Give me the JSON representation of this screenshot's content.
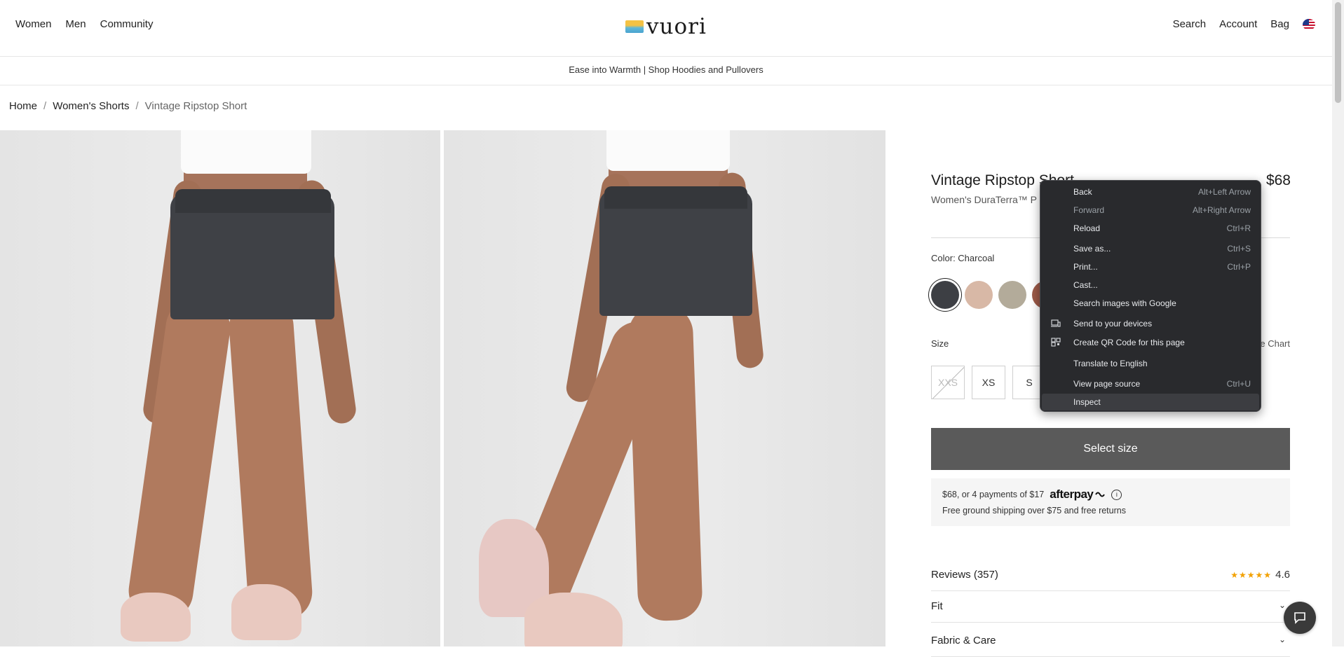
{
  "header": {
    "nav_left": [
      "Women",
      "Men",
      "Community"
    ],
    "logo_text": "vuori",
    "nav_right": [
      "Search",
      "Account",
      "Bag"
    ],
    "flag_icon": "us-flag-icon"
  },
  "banner": {
    "text": "Ease into Warmth | Shop Hoodies and Pullovers"
  },
  "breadcrumb": {
    "items": [
      "Home",
      "Women's Shorts",
      "Vintage Ripstop Short"
    ],
    "separator": "/"
  },
  "product": {
    "title": "Vintage Ripstop Short",
    "price": "$68",
    "subtitle": "Women's DuraTerra™ P",
    "color_label": "Color: Charcoal",
    "swatches": [
      "#3d3f44",
      "#d8b8a6",
      "#b3ab9a",
      "#9c5a48"
    ],
    "size_label": "Size",
    "size_chart_label": "e Chart",
    "sizes": [
      "XXS",
      "XS",
      "S"
    ],
    "select_button": "Select size",
    "afterpay_text": "$68, or 4 payments of $17",
    "afterpay_logo": "afterpay",
    "afterpay_info": "i",
    "shipping_text": "Free ground shipping over $75 and free returns",
    "reviews_label": "Reviews (357)",
    "stars": "★★★★★",
    "rating": "4.6",
    "fit_label": "Fit",
    "fabric_label": "Fabric & Care",
    "chevron": "⌄"
  },
  "context_menu": {
    "items": [
      {
        "label": "Back",
        "shortcut": "Alt+Left Arrow"
      },
      {
        "label": "Forward",
        "shortcut": "Alt+Right Arrow"
      },
      {
        "label": "Reload",
        "shortcut": "Ctrl+R"
      },
      {
        "label": "Save as...",
        "shortcut": "Ctrl+S"
      },
      {
        "label": "Print...",
        "shortcut": "Ctrl+P"
      },
      {
        "label": "Cast...",
        "shortcut": ""
      },
      {
        "label": "Search images with Google",
        "shortcut": ""
      },
      {
        "label": "Send to your devices",
        "shortcut": ""
      },
      {
        "label": "Create QR Code for this page",
        "shortcut": ""
      },
      {
        "label": "Translate to English",
        "shortcut": ""
      },
      {
        "label": "View page source",
        "shortcut": "Ctrl+U"
      },
      {
        "label": "Inspect",
        "shortcut": ""
      }
    ]
  },
  "colors": {
    "accent_dark": "#5a5a5a",
    "menu_bg": "#292a2d",
    "star": "#f2a100"
  }
}
